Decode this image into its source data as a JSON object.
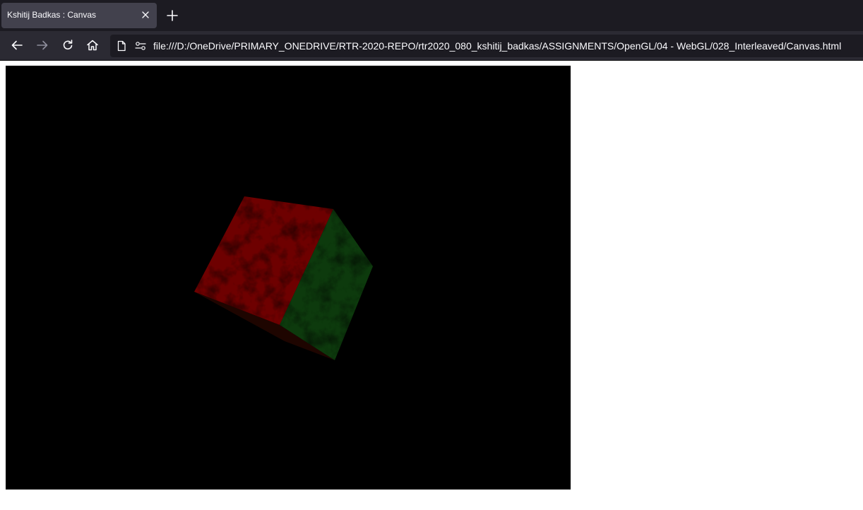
{
  "browser": {
    "tab": {
      "title": "Kshitij Badkas : Canvas",
      "close_icon": "close-icon"
    },
    "new_tab_icon": "plus-icon",
    "nav": {
      "back_icon": "back-arrow-icon",
      "forward_icon": "forward-arrow-icon",
      "reload_icon": "reload-icon",
      "home_icon": "home-icon"
    },
    "url": {
      "value": "file:///D:/OneDrive/PRIMARY_ONEDRIVE/RTR-2020-REPO/rtr2020_080_kshitij_badkas/ASSIGNMENTS/OpenGL/04 - WebGL/028_Interleaved/Canvas.html",
      "page_icon": "document-icon",
      "permissions_icon": "permissions-icon"
    },
    "colors": {
      "tabbar_bg": "#1c1b22",
      "active_tab_bg": "#42414d",
      "navbar_bg": "#2b2a33",
      "text": "#fbfbfe"
    }
  },
  "canvas": {
    "background": "#000000",
    "cube_faces": {
      "front": "#6e0000",
      "right": "#0d3a0d",
      "bottom": "#1e0500"
    }
  }
}
